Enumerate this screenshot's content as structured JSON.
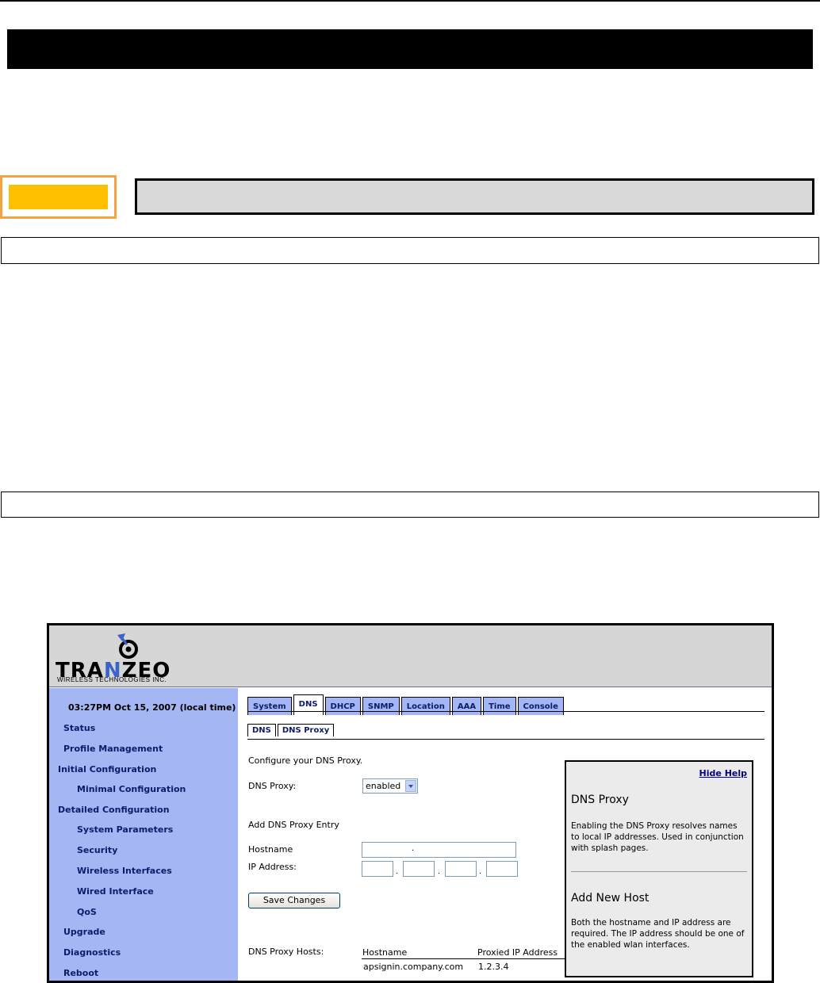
{
  "app": {
    "logo": {
      "brand_pre": "TRA",
      "brand_n": "N",
      "brand_post": "ZEO",
      "subtitle": "WIRELESS TECHNOLOGIES INC."
    },
    "sidebar": {
      "clock": "03:27PM Oct 15, 2007 (local time)",
      "items": [
        "Status",
        "Profile Management",
        "Initial Configuration",
        "Minimal Configuration",
        "Detailed Configuration",
        "System Parameters",
        "Security",
        "Wireless Interfaces",
        "Wired Interface",
        "QoS",
        "Upgrade",
        "Diagnostics",
        "Reboot"
      ]
    },
    "main_tabs": [
      "System",
      "DNS",
      "DHCP",
      "SNMP",
      "Location",
      "AAA",
      "Time",
      "Console"
    ],
    "active_main_tab": "DNS",
    "sub_tabs": [
      "DNS",
      "DNS Proxy"
    ],
    "active_sub_tab": "DNS Proxy",
    "form": {
      "intro": "Configure your DNS Proxy.",
      "proxy_label": "DNS Proxy:",
      "proxy_value": "enabled",
      "add_entry_heading": "Add DNS Proxy Entry",
      "hostname_label": "Hostname",
      "hostname_value": ".",
      "ip_label": "IP Address:",
      "ip_separator": ".",
      "save_label": "Save Changes"
    },
    "hosts": {
      "label": "DNS Proxy Hosts:",
      "columns": [
        "Hostname",
        "Proxied IP Address"
      ],
      "rows": [
        {
          "hostname": "apsignin.company.com",
          "ip": "1.2.3.4"
        }
      ]
    },
    "help": {
      "hide_label": "Hide Help",
      "sections": [
        {
          "title": "DNS Proxy",
          "text": "Enabling the DNS Proxy resolves names to local IP addresses. Used in conjunction with splash pages."
        },
        {
          "title": "Add New Host",
          "text": "Both the hostname and IP address are required. The IP address should be one of the enabled wlan interfaces."
        }
      ]
    }
  },
  "colors": {
    "sidebar": "#a4b6f3",
    "tab": "#a4b6f3",
    "nav_text": "#101a6a",
    "header": "#d6d6d6",
    "help_bg": "#ebebeb",
    "tag_fill": "#ffc000",
    "tag_border": "#f4a340",
    "gray_bar": "#d9d9d9"
  }
}
